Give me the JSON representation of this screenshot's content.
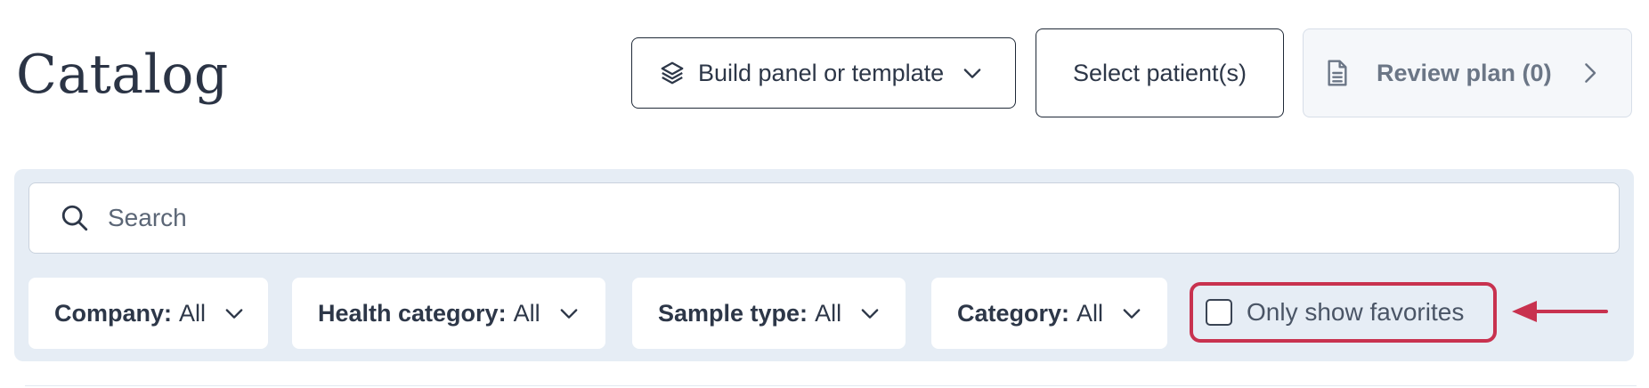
{
  "header": {
    "title": "Catalog",
    "build_label": "Build panel or template",
    "select_label": "Select patient(s)",
    "review_label": "Review plan (0)"
  },
  "search": {
    "placeholder": "Search",
    "value": ""
  },
  "filters": [
    {
      "name": "Company:",
      "value": "All"
    },
    {
      "name": "Health category:",
      "value": "All"
    },
    {
      "name": "Sample type:",
      "value": "All"
    },
    {
      "name": "Category:",
      "value": "All"
    }
  ],
  "favorites": {
    "label": "Only show favorites",
    "checked": false
  },
  "icons": {
    "build": "layers-icon",
    "dropdown": "chevron-down-icon",
    "review": "document-icon",
    "review_arrow": "chevron-right-icon",
    "search": "search-icon",
    "annotation": "arrow-left-icon"
  },
  "colors": {
    "highlight": "#c8324f",
    "panel": "#e6edf5",
    "title": "#2b3445"
  }
}
